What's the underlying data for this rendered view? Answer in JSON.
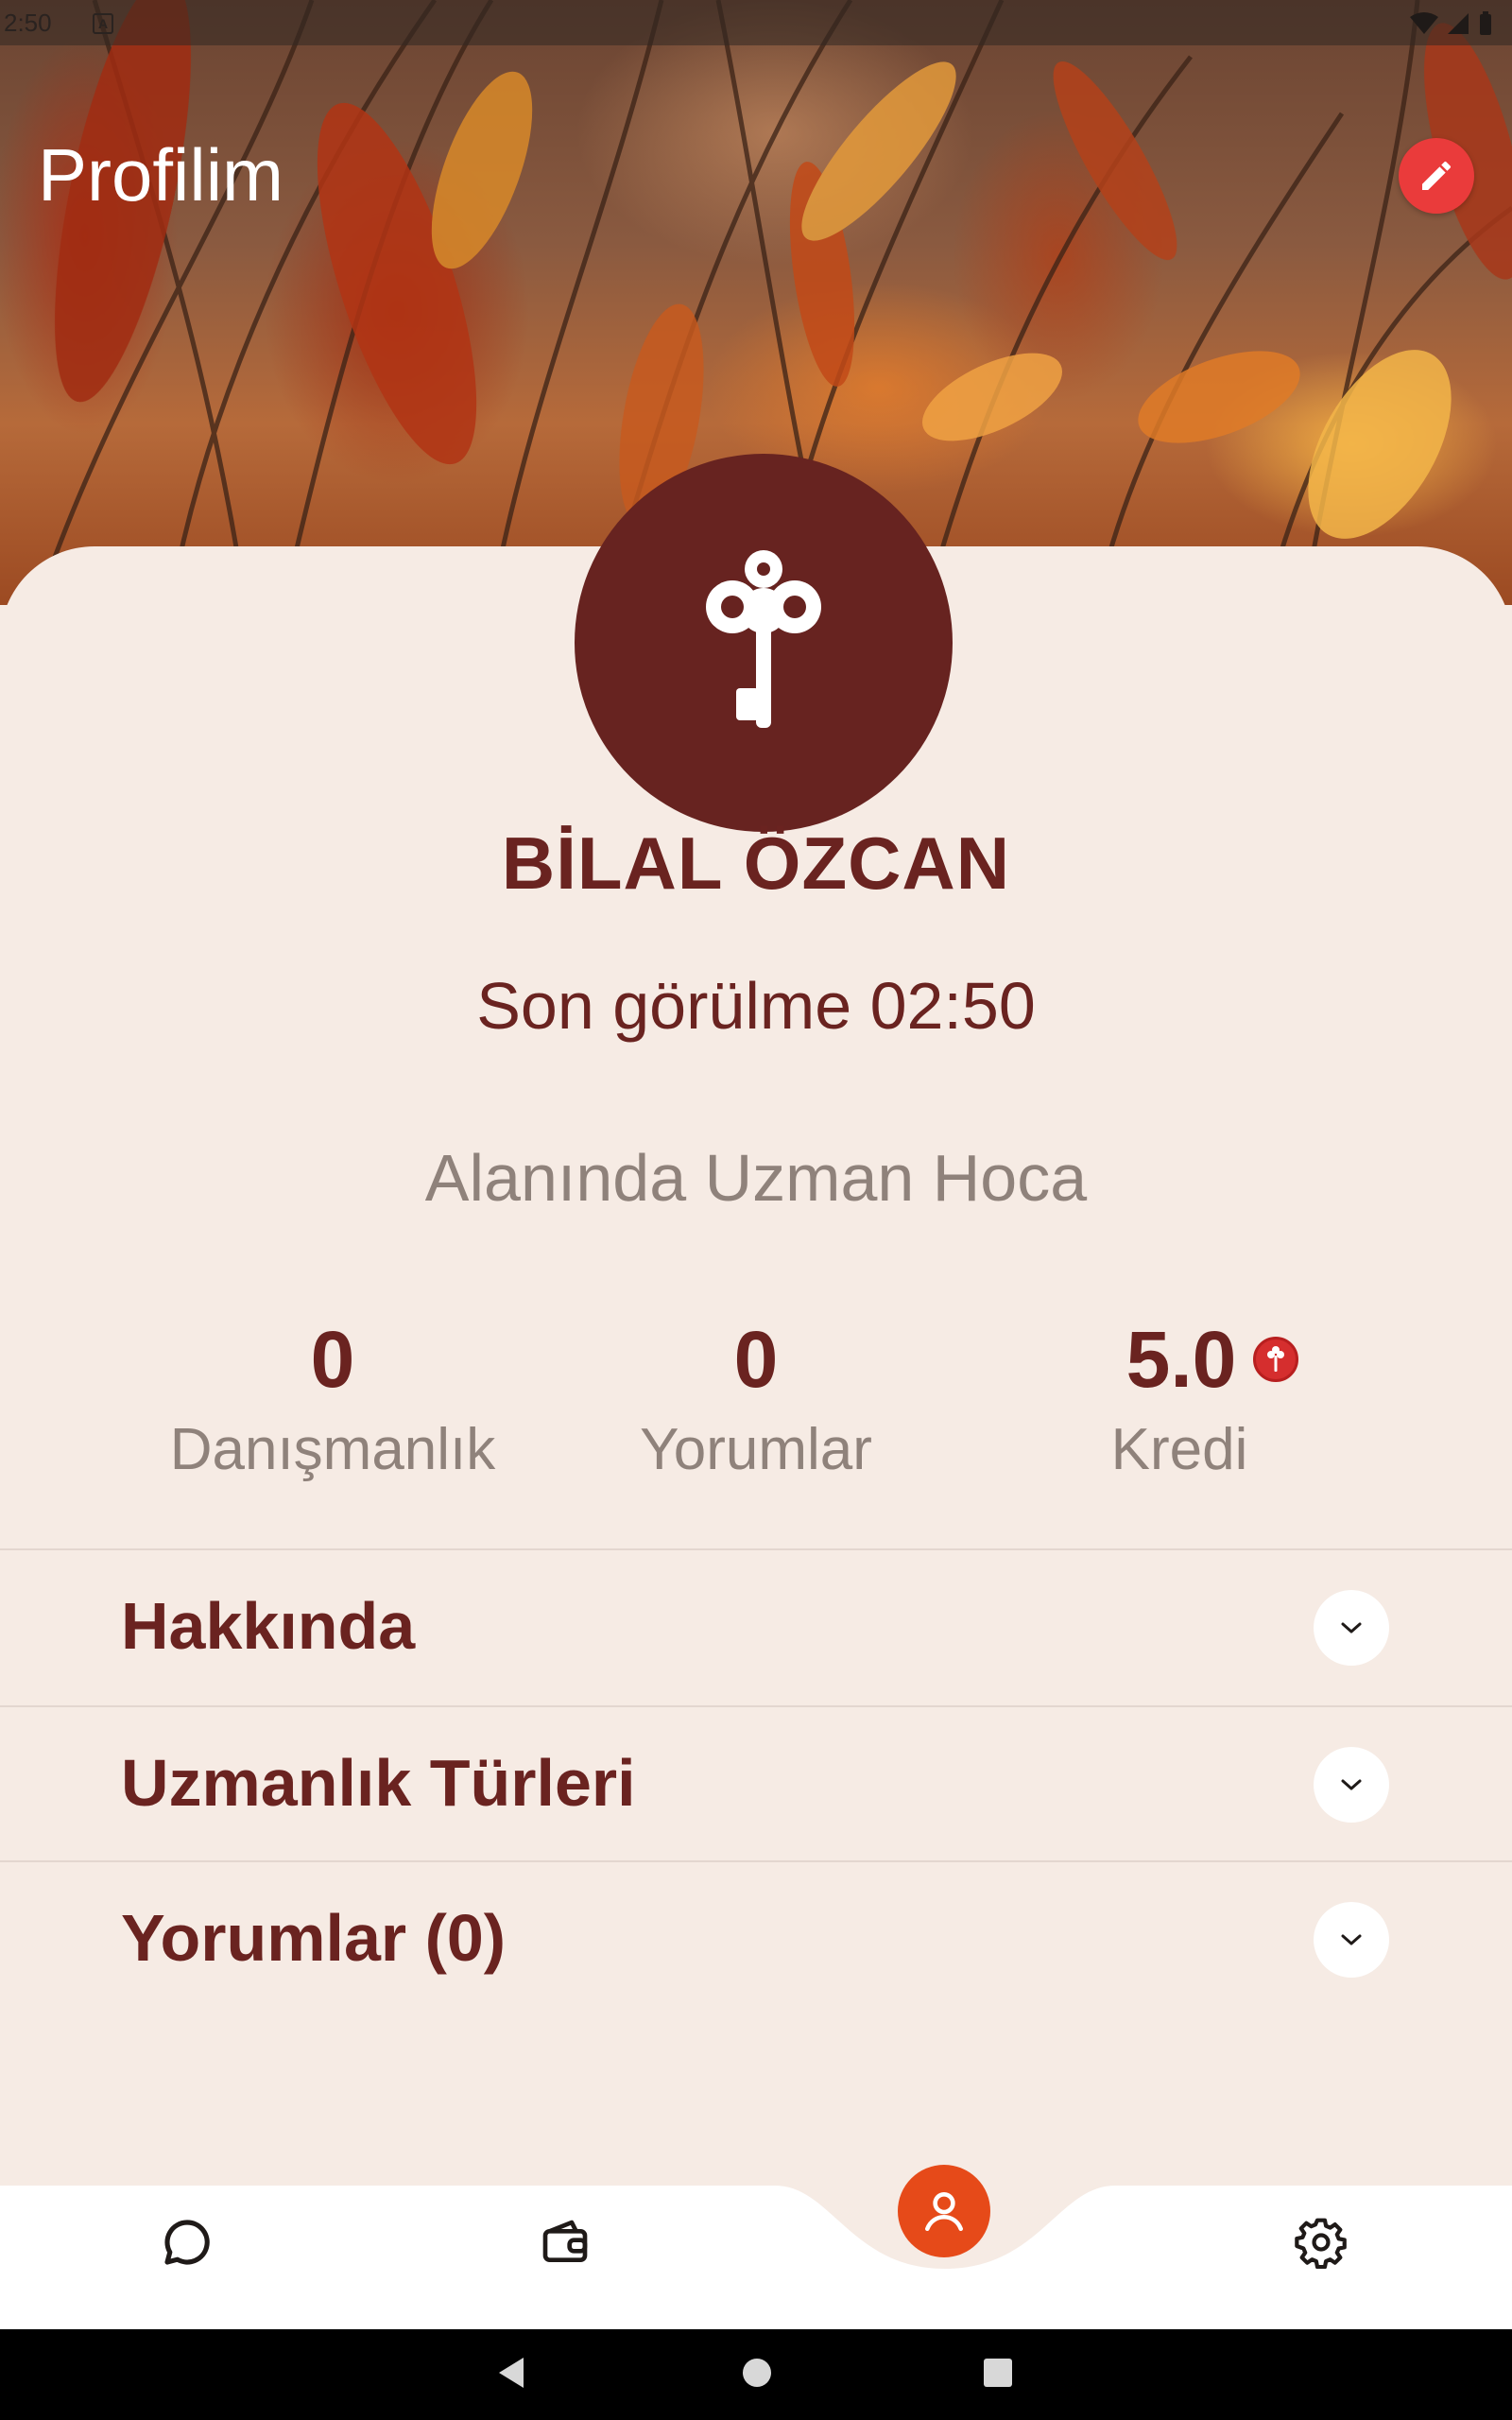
{
  "status_bar": {
    "time": "2:50"
  },
  "header": {
    "title": "Profilim"
  },
  "profile": {
    "name": "BİLAL ÖZCAN",
    "last_seen": "Son görülme 02:50",
    "subtitle": "Alanında Uzman Hoca"
  },
  "stats": [
    {
      "value": "0",
      "label": "Danışmanlık"
    },
    {
      "value": "0",
      "label": "Yorumlar"
    },
    {
      "value": "5.0",
      "label": "Kredi"
    }
  ],
  "sections": [
    {
      "label": "Hakkında"
    },
    {
      "label": "Uzmanlık Türleri"
    },
    {
      "label": "Yorumlar (0)"
    }
  ],
  "bottom_nav": {
    "items": [
      "chat-icon",
      "wallet-icon",
      "profile-icon",
      "settings-icon"
    ],
    "active": "profile-icon"
  },
  "colors": {
    "primary": "#6a2320",
    "accent": "#e64a19",
    "edit_button": "#ea3b3b",
    "muted": "#8f827b",
    "card_bg": "#f6ebe4"
  }
}
